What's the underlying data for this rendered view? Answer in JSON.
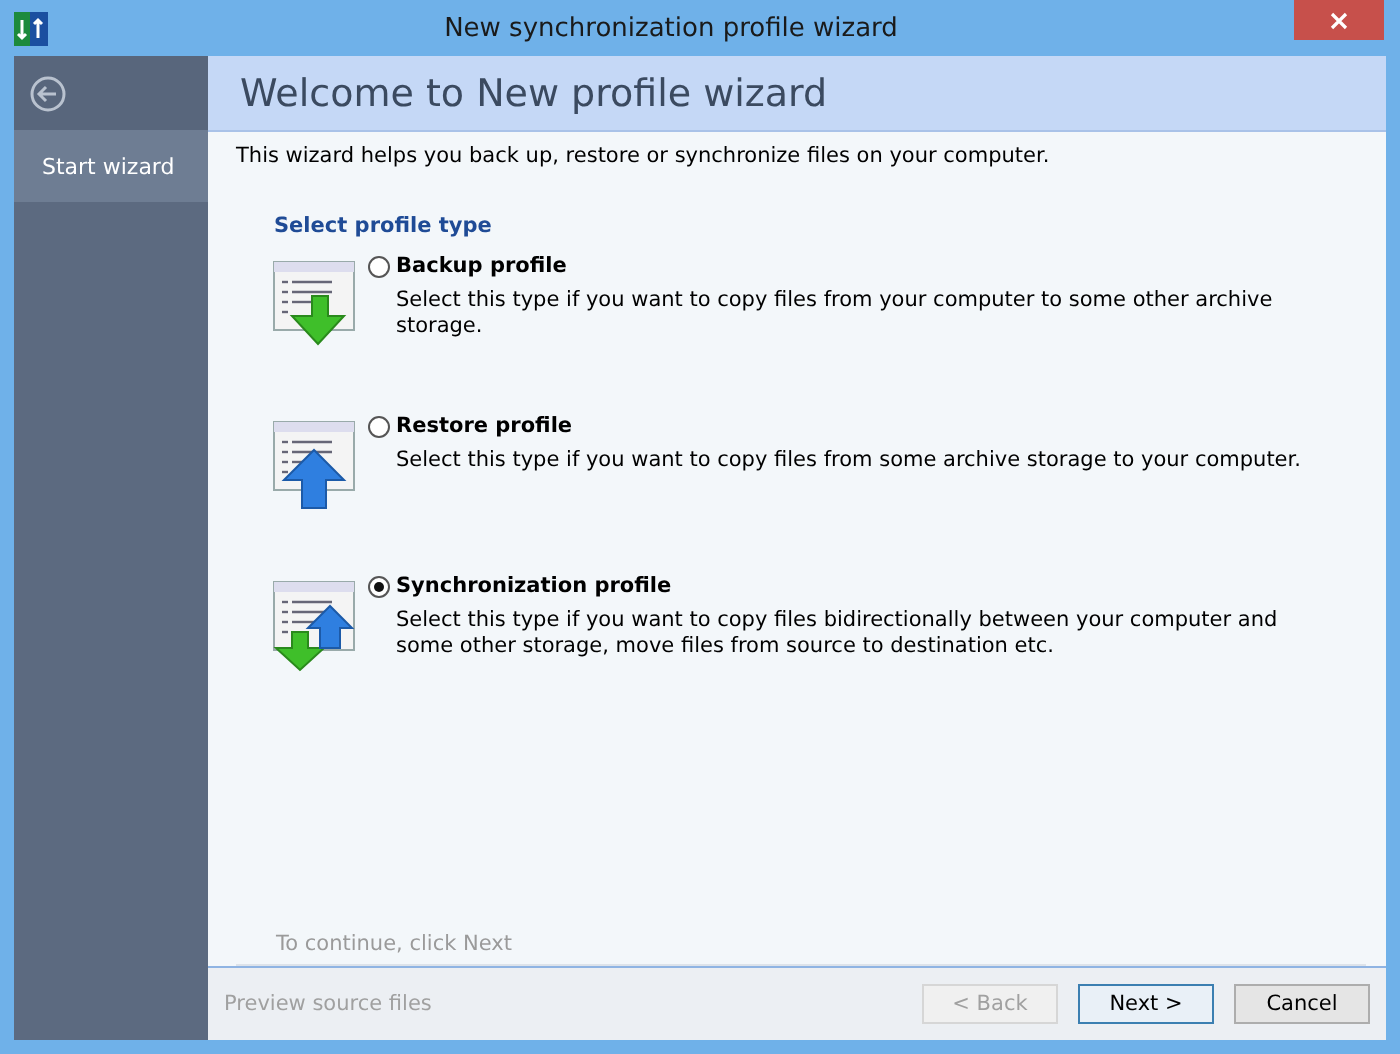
{
  "window": {
    "title": "New synchronization profile wizard"
  },
  "sidebar": {
    "items": [
      {
        "label": "Start wizard",
        "selected": true
      }
    ]
  },
  "header": {
    "title": "Welcome to New profile wizard"
  },
  "intro": "This wizard helps you back up, restore or synchronize files on your computer.",
  "section_title": "Select profile type",
  "profiles": [
    {
      "kind": "backup",
      "label": "Backup profile",
      "description": "Select this type if you want to copy files from your computer to some other archive storage.",
      "selected": false
    },
    {
      "kind": "restore",
      "label": "Restore profile",
      "description": "Select this type if you want to copy files from some archive storage to your computer.",
      "selected": false
    },
    {
      "kind": "sync",
      "label": "Synchronization profile",
      "description": "Select this type if you want to copy files bidirectionally between your computer and some other storage, move files from source to destination etc.",
      "selected": true
    }
  ],
  "hint": "To continue, click Next",
  "footer": {
    "link": "Preview source files",
    "link_disabled": true,
    "buttons": [
      {
        "label": "< Back",
        "disabled": true,
        "default": false
      },
      {
        "label": "Next >",
        "disabled": false,
        "default": true
      },
      {
        "label": "Cancel",
        "disabled": false,
        "default": false
      }
    ]
  }
}
